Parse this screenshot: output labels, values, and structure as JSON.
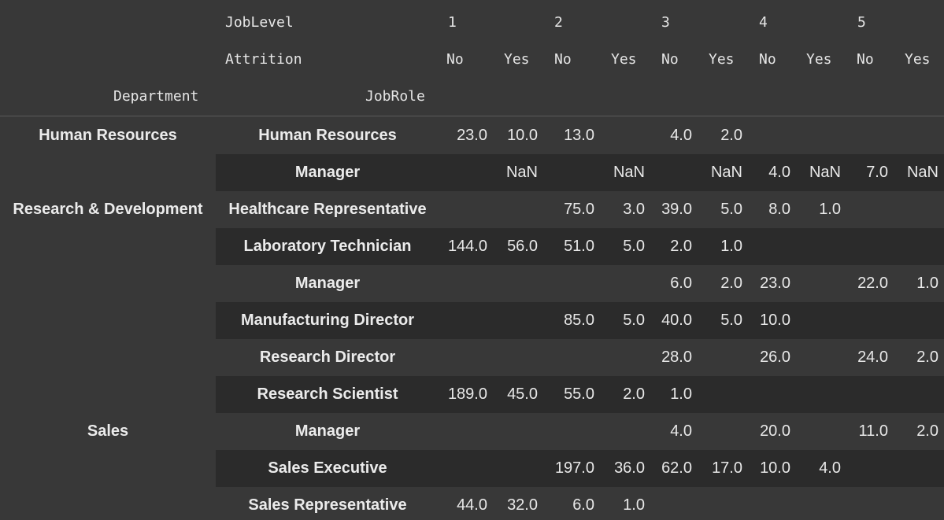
{
  "header": {
    "level_label": "JobLevel",
    "attrition_label": "Attrition",
    "department_label": "Department",
    "jobrole_label": "JobRole",
    "levels": [
      "1",
      "2",
      "3",
      "4",
      "5"
    ],
    "attrition_values": [
      "No",
      "Yes",
      "No",
      "Yes",
      "No",
      "Yes",
      "No",
      "Yes",
      "No",
      "Yes"
    ]
  },
  "departments": [
    {
      "label": "Human Resources",
      "row": 0
    },
    {
      "label": "Research & Development",
      "row": 2
    },
    {
      "label": "Sales",
      "row": 8
    }
  ],
  "rows": [
    {
      "role": "Human Resources",
      "values": [
        "23.0",
        "10.0",
        "13.0",
        "",
        "4.0",
        "2.0",
        "",
        "",
        "",
        ""
      ]
    },
    {
      "role": "Manager",
      "values": [
        "",
        "NaN",
        "",
        "NaN",
        "",
        "NaN",
        "4.0",
        "NaN",
        "7.0",
        "NaN"
      ]
    },
    {
      "role": "Healthcare Representative",
      "values": [
        "",
        "",
        "75.0",
        "3.0",
        "39.0",
        "5.0",
        "8.0",
        "1.0",
        "",
        ""
      ]
    },
    {
      "role": "Laboratory Technician",
      "values": [
        "144.0",
        "56.0",
        "51.0",
        "5.0",
        "2.0",
        "1.0",
        "",
        "",
        "",
        ""
      ]
    },
    {
      "role": "Manager",
      "values": [
        "",
        "",
        "",
        "",
        "6.0",
        "2.0",
        "23.0",
        "",
        "22.0",
        "1.0"
      ]
    },
    {
      "role": "Manufacturing Director",
      "values": [
        "",
        "",
        "85.0",
        "5.0",
        "40.0",
        "5.0",
        "10.0",
        "",
        "",
        ""
      ]
    },
    {
      "role": "Research Director",
      "values": [
        "",
        "",
        "",
        "",
        "28.0",
        "",
        "26.0",
        "",
        "24.0",
        "2.0"
      ]
    },
    {
      "role": "Research Scientist",
      "values": [
        "189.0",
        "45.0",
        "55.0",
        "2.0",
        "1.0",
        "",
        "",
        "",
        "",
        ""
      ]
    },
    {
      "role": "Manager",
      "values": [
        "",
        "",
        "",
        "",
        "4.0",
        "",
        "20.0",
        "",
        "11.0",
        "2.0"
      ]
    },
    {
      "role": "Sales Executive",
      "values": [
        "",
        "",
        "197.0",
        "36.0",
        "62.0",
        "17.0",
        "10.0",
        "4.0",
        "",
        ""
      ]
    },
    {
      "role": "Sales Representative",
      "values": [
        "44.0",
        "32.0",
        "6.0",
        "1.0",
        "",
        "",
        "",
        "",
        "",
        ""
      ]
    }
  ]
}
